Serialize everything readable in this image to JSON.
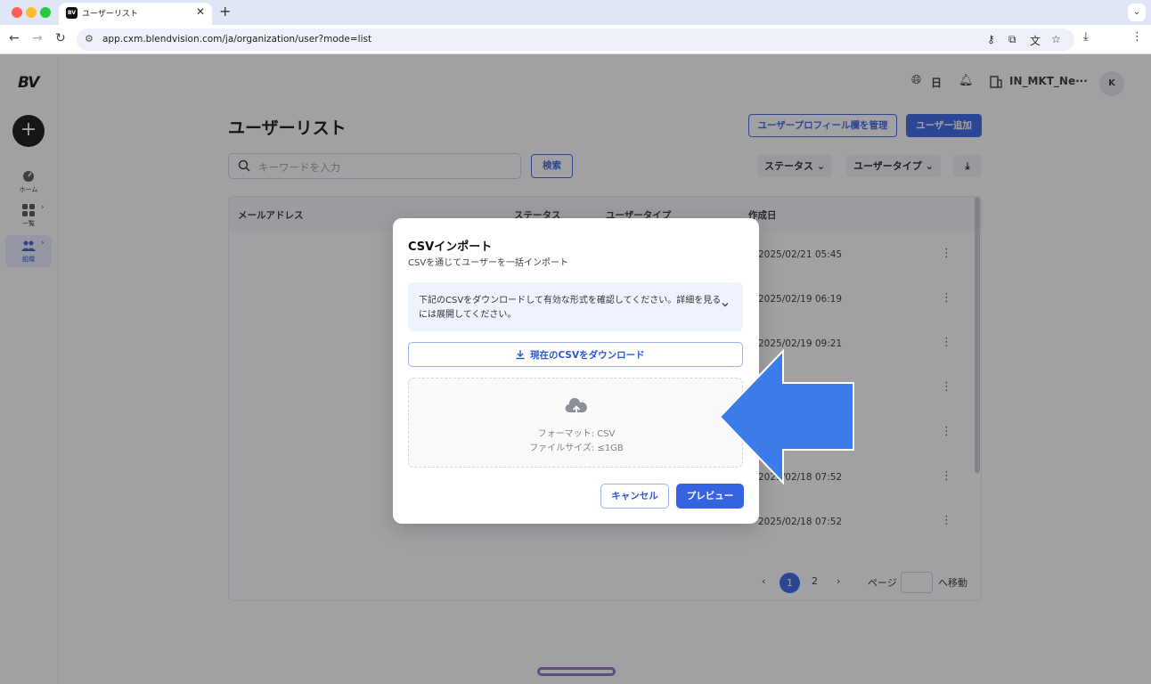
{
  "browser": {
    "tab_title": "ユーザーリスト",
    "tab_favicon": "BV",
    "url": "app.cxm.blendvision.com/ja/organization/user?mode=list",
    "traffic_colors": [
      "#fe5f57",
      "#febc2e",
      "#28c840"
    ]
  },
  "sidebar": {
    "logo": "BV",
    "items": [
      {
        "label": "ホーム",
        "icon": "home-icon"
      },
      {
        "label": "一覧",
        "icon": "grid-icon"
      },
      {
        "label": "組織",
        "icon": "users-icon"
      }
    ]
  },
  "header": {
    "language": "日",
    "org": "IN_MKT_Ne···",
    "avatar": "K"
  },
  "page": {
    "title": "ユーザーリスト",
    "manage_fields_button": "ユーザープロフィール欄を管理",
    "add_user_button": "ユーザー追加",
    "search_placeholder": "キーワードを入力",
    "search_button": "検索",
    "status_filter": "ステータス",
    "usertype_filter": "ユーザータイプ"
  },
  "table": {
    "columns": [
      "メールアドレス",
      "ステータス",
      "ユーザータイプ",
      "作成日"
    ],
    "dates": [
      "2025/02/21 05:45",
      "2025/02/19 06:19",
      "2025/02/19 09:21",
      "",
      "",
      "2025/02/18 07:52",
      "2025/02/18 07:52"
    ]
  },
  "pagination": {
    "pages": [
      "1",
      "2"
    ],
    "current": "1",
    "page_label": "ページ",
    "goto_label": "へ移動"
  },
  "modal": {
    "title": "CSVインポート",
    "subtitle": "CSVを通じてユーザーを一括インポート",
    "info": "下記のCSVをダウンロードして有効な形式を確認してください。詳細を見るには展開してください。",
    "download_button": "現在のCSVをダウンロード",
    "format_line": "フォーマット: CSV",
    "size_line": "ファイルサイズ: ≤1GB",
    "cancel_button": "キャンセル",
    "preview_button": "プレビュー"
  },
  "colors": {
    "primary": "#3563e2",
    "arrow": "#3b7bea"
  }
}
